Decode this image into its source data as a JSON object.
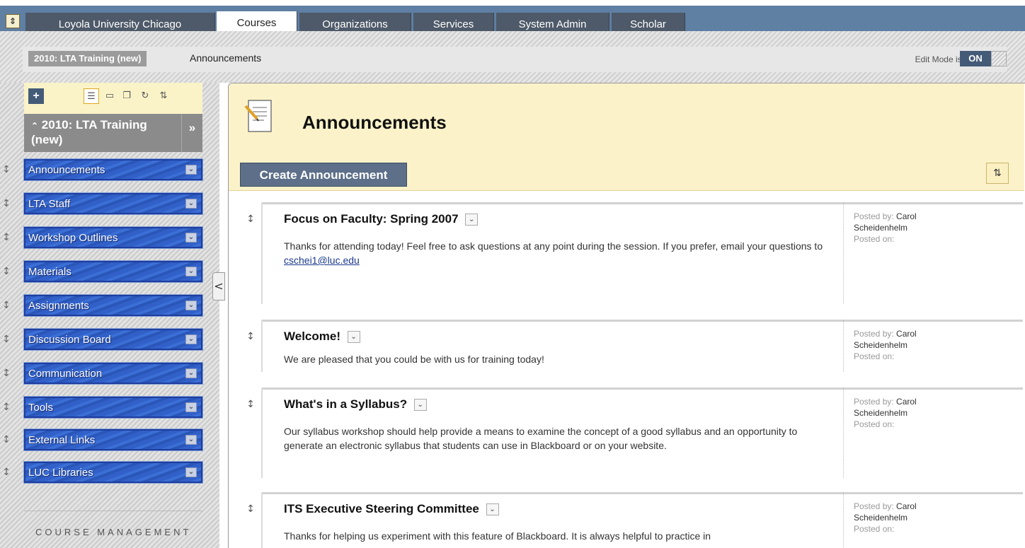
{
  "topbar": {
    "toggle_glyph": "⇕",
    "tabs": [
      {
        "label": "Loyola University Chicago"
      },
      {
        "label": "Courses"
      },
      {
        "label": "Organizations"
      },
      {
        "label": "Services"
      },
      {
        "label": "System Admin"
      },
      {
        "label": "Scholar"
      }
    ],
    "active_tab": "Courses"
  },
  "course_bar": {
    "course_chip": "2010: LTA Training (new)",
    "breadcrumb": "Announcements",
    "edit_mode_label": "Edit Mode is:",
    "edit_mode_value": "ON"
  },
  "sidebar": {
    "add_glyph": "+",
    "tool_icons": [
      "list-view-icon",
      "folder-icon",
      "window-icon",
      "refresh-icon",
      "sort-icon"
    ],
    "course_title": "2010: LTA Training (new)",
    "collapse_glyph": "»",
    "title_caret": "^",
    "items": [
      {
        "label": "Announcements"
      },
      {
        "label": "LTA Staff"
      },
      {
        "label": "Workshop Outlines"
      },
      {
        "label": "Materials"
      },
      {
        "label": "Assignments"
      },
      {
        "label": "Discussion Board"
      },
      {
        "label": "Communication"
      },
      {
        "label": "Tools"
      },
      {
        "label": "External Links"
      },
      {
        "label": "LUC Libraries"
      }
    ],
    "footer_label": "COURSE MANAGEMENT",
    "pane_toggle_glyph": "<"
  },
  "content": {
    "page_title": "Announcements",
    "create_button": "Create Announcement",
    "reorder_glyph": "⇅",
    "announcements": [
      {
        "title": "Focus on Faculty: Spring 2007",
        "body": "Thanks for attending today! Feel free to ask questions at any point during the session. If you prefer, email your questions to ",
        "link": "cschei1@luc.edu",
        "posted_by_label": "Posted by:",
        "author_first": "Carol",
        "author_last": "Scheidenhelm",
        "posted_on_label": "Posted on:"
      },
      {
        "title": "Welcome!",
        "body": "We are pleased that you could be with us for training today!",
        "posted_by_label": "Posted by:",
        "author_first": "Carol",
        "author_last": "Scheidenhelm",
        "posted_on_label": "Posted on:"
      },
      {
        "title": "What's in a Syllabus?",
        "body": "Our syllabus workshop should help provide a means to examine the concept of a good syllabus and an opportunity to generate an electronic syllabus that students can use in Blackboard or on your website.",
        "posted_by_label": "Posted by:",
        "author_first": "Carol",
        "author_last": "Scheidenhelm",
        "posted_on_label": "Posted on:"
      },
      {
        "title": "ITS Executive Steering Committee",
        "body": "Thanks for helping us experiment with this feature of Blackboard. It is always helpful to practice in",
        "posted_by_label": "Posted by:",
        "author_first": "Carol",
        "author_last": "Scheidenhelm",
        "posted_on_label": "Posted on:"
      }
    ]
  },
  "colors": {
    "tab_bar": "#5f7fa3",
    "tab_inactive": "#4e5a69",
    "menu_blue": "#3160c8",
    "header_yellow": "#fcf2c9",
    "button_slate": "#5d6f89"
  }
}
